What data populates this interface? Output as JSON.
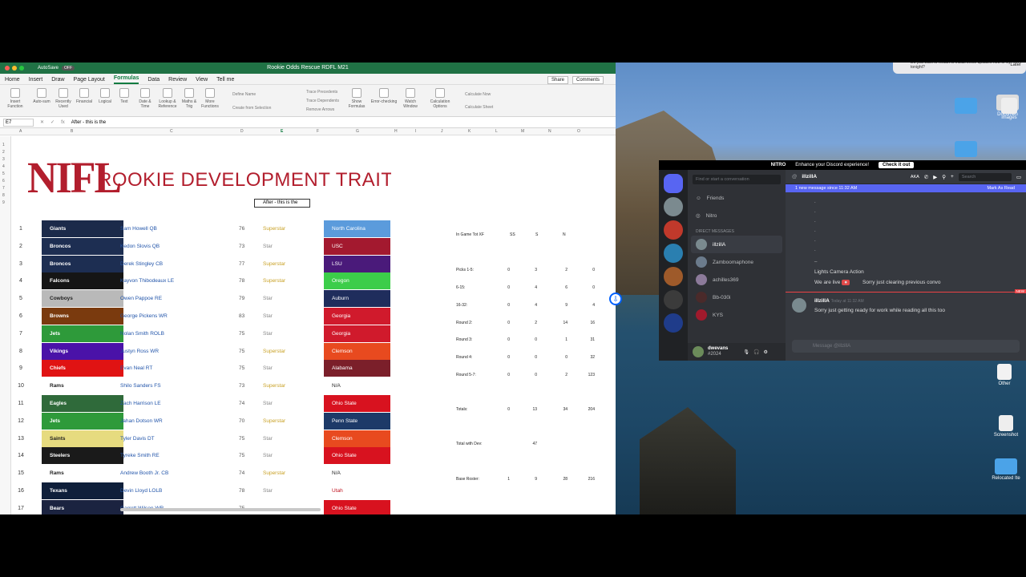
{
  "excel": {
    "autosave": "AutoSave",
    "autosave_state": "OFF",
    "title": "Rookie Odds Rescue RDFL M21",
    "tabs": [
      "Home",
      "Insert",
      "Draw",
      "Page Layout",
      "Formulas",
      "Data",
      "Review",
      "View",
      "Tell me"
    ],
    "active_tab": "Formulas",
    "share": "Share",
    "comments": "Comments",
    "ribbon": {
      "buttons": [
        "Insert Function",
        "Auto-sum",
        "Recently Used",
        "Financial",
        "Logical",
        "Text",
        "Date & Time",
        "Lookup & Reference",
        "Maths & Trig",
        "More Functions"
      ],
      "define_name": "Define Name",
      "create_from_selection": "Create from Selection",
      "trace_precedents": "Trace Precedents",
      "trace_dependents": "Trace Dependents",
      "remove_arrows": "Remove Arrows",
      "show_formulas": "Show Formulas",
      "error_checking": "Error-checking",
      "watch_window": "Watch Window",
      "calculation_options": "Calculation Options",
      "calculate_now": "Calculate Now",
      "calculate_sheet": "Calculate Sheet"
    },
    "name_box": "E7",
    "formula": "After - this is the",
    "columns": [
      "A",
      "B",
      "C",
      "D",
      "E",
      "F",
      "G",
      "H",
      "I",
      "J",
      "K",
      "L",
      "M",
      "N",
      "O"
    ],
    "logo": "NIFL",
    "heading": "ROOKIE DEVELOPMENT TRAITS",
    "selected_cell_text": "After - this is the",
    "rows": [
      {
        "n": "1",
        "team": "Giants",
        "team_color": "#1b2a4a",
        "player": "Sam Howell QB",
        "ovr": "76",
        "trait": "Superstar",
        "college": "North Carolina",
        "college_color": "#5b9bdc"
      },
      {
        "n": "2",
        "team": "Broncos",
        "team_color": "#1d2e52",
        "player": "Kedon Slovis QB",
        "ovr": "73",
        "trait": "Star",
        "college": "USC",
        "college_color": "#a3192f"
      },
      {
        "n": "3",
        "team": "Broncos",
        "team_color": "#1d2e52",
        "player": "Derek Stingley CB",
        "ovr": "77",
        "trait": "Superstar",
        "college": "LSU",
        "college_color": "#4a1a7a"
      },
      {
        "n": "4",
        "team": "Falcons",
        "team_color": "#151515",
        "player": "Kayvon Thibodeaux LE",
        "ovr": "78",
        "trait": "Superstar",
        "college": "Oregon",
        "college_color": "#3ccd4a"
      },
      {
        "n": "5",
        "team": "Cowboys",
        "team_color": "#b9b9b9",
        "player": "Owen Pappoe RE",
        "ovr": "79",
        "trait": "Star",
        "college": "Auburn",
        "college_color": "#1f2d5c"
      },
      {
        "n": "6",
        "team": "Browns",
        "team_color": "#7a3a0e",
        "player": "George Pickens WR",
        "ovr": "83",
        "trait": "Star",
        "college": "Georgia",
        "college_color": "#d01a2c"
      },
      {
        "n": "7",
        "team": "Jets",
        "team_color": "#2e9a3a",
        "player": "Nolan Smith ROLB",
        "ovr": "75",
        "trait": "Star",
        "college": "Georgia",
        "college_color": "#d01a2c"
      },
      {
        "n": "8",
        "team": "Vikings",
        "team_color": "#4a12a8",
        "player": "Justyn Ross WR",
        "ovr": "75",
        "trait": "Superstar",
        "college": "Clemson",
        "college_color": "#e84a1f"
      },
      {
        "n": "9",
        "team": "Chiefs",
        "team_color": "#e01313",
        "player": "Evan Neal RT",
        "ovr": "75",
        "trait": "Star",
        "college": "Alabama",
        "college_color": "#7b1f2a"
      },
      {
        "n": "10",
        "team": "Rams",
        "team_color": "#ffffff",
        "player": "Shilo  Sanders FS",
        "ovr": "73",
        "trait": "Superstar",
        "college": "N/A",
        "college_color": "#ffffff"
      },
      {
        "n": "11",
        "team": "Eagles",
        "team_color": "#2f6a3a",
        "player": "Zach Harrison LE",
        "ovr": "74",
        "trait": "Star",
        "college": "Ohio State",
        "college_color": "#d8121f"
      },
      {
        "n": "12",
        "team": "Jets",
        "team_color": "#2e9a3a",
        "player": "Jahan Dotson WR",
        "ovr": "70",
        "trait": "Superstar",
        "college": "Penn State",
        "college_color": "#1d3a68"
      },
      {
        "n": "13",
        "team": "Saints",
        "team_color": "#e6db7f",
        "player": "Tyler Davis DT",
        "ovr": "75",
        "trait": "Star",
        "college": "Clemson",
        "college_color": "#e84a1f"
      },
      {
        "n": "14",
        "team": "Steelers",
        "team_color": "#1a1a1a",
        "player": "Tyreke Smith RE",
        "ovr": "75",
        "trait": "Star",
        "college": "Ohio State",
        "college_color": "#d8121f"
      },
      {
        "n": "15",
        "team": "Rams",
        "team_color": "#ffffff",
        "player": "Andrew Booth Jr. CB",
        "ovr": "74",
        "trait": "Superstar",
        "college": "N/A",
        "college_color": "#ffffff"
      },
      {
        "n": "16",
        "team": "Texans",
        "team_color": "#0f1f3a",
        "player": "Devin Lloyd LOLB",
        "ovr": "78",
        "trait": "Star",
        "college": "Utah",
        "college_color": "#ffffff"
      },
      {
        "n": "17",
        "team": "Bears",
        "team_color": "#1b2340",
        "player": "Garrett Wilson WR",
        "ovr": "75",
        "trait": "",
        "college": "Ohio State",
        "college_color": "#d8121f"
      }
    ],
    "stats": {
      "header": [
        "In Game Tot XF",
        "SS",
        "S",
        "N"
      ],
      "lines": [
        {
          "label": "Picks 1-5:",
          "v": [
            "0",
            "3",
            "2",
            "0"
          ]
        },
        {
          "label": "6-15:",
          "v": [
            "0",
            "4",
            "6",
            "0"
          ]
        },
        {
          "label": "16-32:",
          "v": [
            "0",
            "4",
            "9",
            "4"
          ]
        },
        {
          "label": "Round 2:",
          "v": [
            "0",
            "2",
            "14",
            "16"
          ]
        },
        {
          "label": "Round 3:",
          "v": [
            "0",
            "0",
            "1",
            "31"
          ]
        },
        {
          "label": "Round 4:",
          "v": [
            "0",
            "0",
            "0",
            "32"
          ]
        },
        {
          "label": "Round 5-7:",
          "v": [
            "0",
            "0",
            "2",
            "123"
          ]
        },
        {
          "label": "Totals:",
          "v": [
            "0",
            "13",
            "34",
            "204"
          ]
        },
        {
          "label": "Total with Dev:",
          "v": [
            "",
            "47",
            "",
            ""
          ]
        },
        {
          "label": "Base Roster:",
          "v": [
            "1",
            "9",
            "28",
            "216"
          ]
        }
      ]
    }
  },
  "desktop": {
    "notification": "Do you want to restart to install these updates now or try tonight?",
    "notification_later": "Later",
    "icons": [
      "Documen",
      "images",
      "Other",
      "Screenshot",
      "Relocated Ite"
    ]
  },
  "discord": {
    "nitro_label": "NITRO",
    "nitro_text": "Enhance your Discord experience!",
    "nitro_button": "Check it out",
    "search_placeholder": "Find or start a conversation",
    "friends": "Friends",
    "nitro": "Nitro",
    "dm_header": "DIRECT MESSAGES",
    "dms": [
      "illzillA",
      "Zamboomaphone",
      "achilles369",
      "Bb-030i",
      "KYS"
    ],
    "username": "dwevans",
    "user_tag": "#2024",
    "channel": "illzillA",
    "aka": "AKA",
    "search": "Search",
    "new_messages": "1 new message since 11:32 AM",
    "mark_as_read": "Mark As Read",
    "msg_lines": [
      "Lights Camera Action",
      "We are live",
      "Sorry just clearing previous convo"
    ],
    "author": "illzillA",
    "timestamp": "Today at 11:32 AM",
    "message": "Sorry just getting ready for work while reading all this too",
    "new_badge": "NEW",
    "input_placeholder": "Message @illzillA"
  }
}
